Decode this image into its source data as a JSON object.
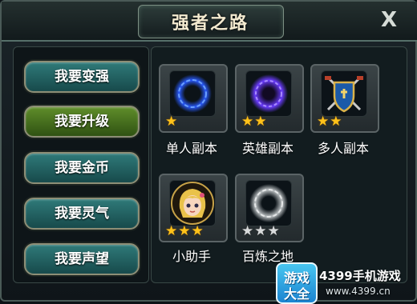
{
  "window": {
    "title": "强者之路",
    "close_label": "X"
  },
  "menu": [
    {
      "label": "我要变强",
      "active": false
    },
    {
      "label": "我要升级",
      "active": true
    },
    {
      "label": "我要金币",
      "active": false
    },
    {
      "label": "我要灵气",
      "active": false
    },
    {
      "label": "我要声望",
      "active": false
    }
  ],
  "tiles": [
    {
      "label": "单人副本",
      "icon": "blue-vortex-icon",
      "stars_total": 1,
      "stars_lit": 1
    },
    {
      "label": "英雄副本",
      "icon": "purple-vortex-icon",
      "stars_total": 2,
      "stars_lit": 2
    },
    {
      "label": "多人副本",
      "icon": "shield-crossed-swords-icon",
      "stars_total": 2,
      "stars_lit": 2
    },
    {
      "label": "小助手",
      "icon": "blonde-girl-avatar-icon",
      "stars_total": 3,
      "stars_lit": 3
    },
    {
      "label": "百炼之地",
      "icon": "grey-vortex-icon",
      "stars_total": 3,
      "stars_lit": 0
    }
  ],
  "watermark": {
    "logo_line1": "游戏",
    "logo_line2": "大全",
    "text": "4399手机游戏",
    "url": "www.4399.cn"
  },
  "colors": {
    "star_lit": "#ffc21a",
    "star_unlit": "#d8dadb",
    "menu_button": "#2f7a79",
    "menu_button_active": "#5f8d2a"
  }
}
